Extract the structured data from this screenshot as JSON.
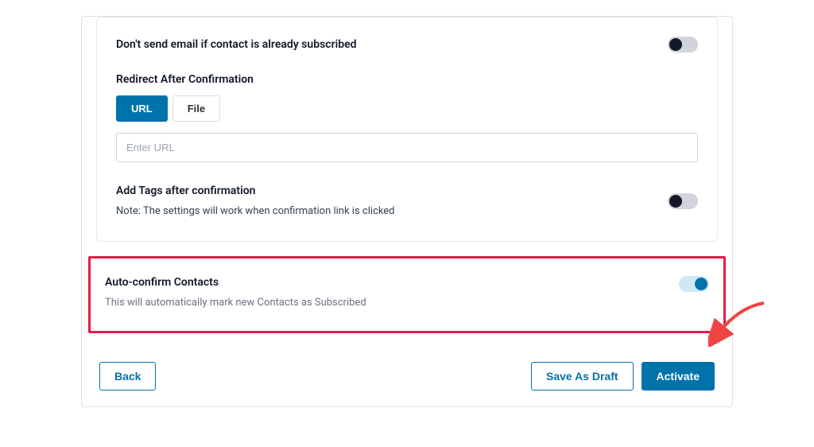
{
  "settings": {
    "dont_send_label": "Don't send email if contact is already subscribed",
    "redirect_heading": "Redirect After Confirmation",
    "tabs": {
      "url": "URL",
      "file": "File"
    },
    "url_placeholder": "Enter URL",
    "add_tags_label": "Add Tags after confirmation",
    "add_tags_note": "Note: The settings will work when confirmation link is clicked"
  },
  "auto_confirm": {
    "title": "Auto-confirm Contacts",
    "desc": "This will automatically mark new Contacts as Subscribed"
  },
  "buttons": {
    "back": "Back",
    "save_draft": "Save As Draft",
    "activate": "Activate"
  }
}
